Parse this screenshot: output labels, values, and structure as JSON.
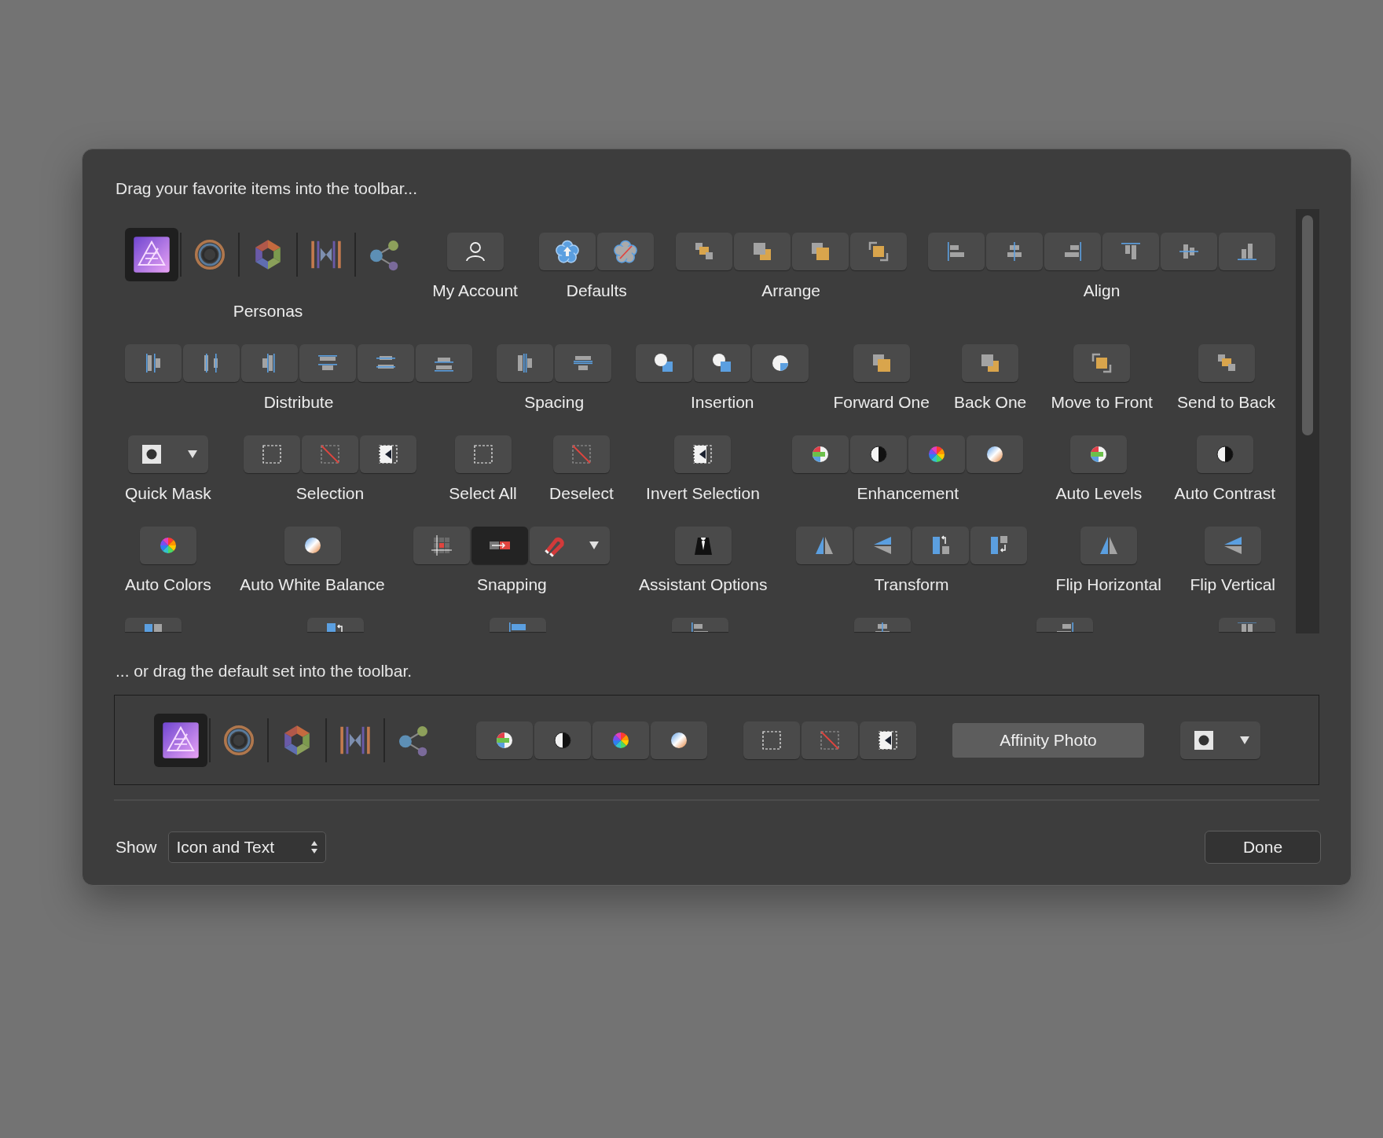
{
  "dialog": {
    "prompt": "Drag your favorite items into the toolbar...",
    "rows": [
      {
        "groups": [
          {
            "kind": "personas",
            "label": "Personas",
            "items": [
              {
                "kind": "photo",
                "selected": true
              },
              {
                "kind": "liquify",
                "selected": false
              },
              {
                "kind": "develop",
                "selected": false
              },
              {
                "kind": "tonemap",
                "selected": false
              },
              {
                "kind": "export",
                "selected": false
              }
            ]
          },
          {
            "kind": "buttons",
            "label": "My Account",
            "items": [
              {
                "kind": "user"
              }
            ]
          },
          {
            "kind": "buttons",
            "label": "Defaults",
            "items": [
              {
                "kind": "defaults-save"
              },
              {
                "kind": "defaults-reset"
              }
            ]
          },
          {
            "kind": "buttons",
            "label": "Arrange",
            "items": [
              {
                "kind": "send-back"
              },
              {
                "kind": "back-one"
              },
              {
                "kind": "forward-one"
              },
              {
                "kind": "to-front"
              }
            ]
          },
          {
            "kind": "buttons",
            "label": "Align",
            "items": [
              {
                "kind": "align-left"
              },
              {
                "kind": "align-center"
              },
              {
                "kind": "align-right"
              },
              {
                "kind": "align-top"
              },
              {
                "kind": "align-middle"
              },
              {
                "kind": "align-bottom"
              }
            ]
          }
        ]
      },
      {
        "groups": [
          {
            "kind": "buttons",
            "label": "Distribute",
            "items": [
              {
                "kind": "dist-left"
              },
              {
                "kind": "dist-center"
              },
              {
                "kind": "dist-right"
              },
              {
                "kind": "dist-top"
              },
              {
                "kind": "dist-middle"
              },
              {
                "kind": "dist-bottom"
              }
            ]
          },
          {
            "kind": "buttons",
            "label": "Spacing",
            "items": [
              {
                "kind": "space-h"
              },
              {
                "kind": "space-v"
              }
            ]
          },
          {
            "kind": "buttons",
            "label": "Insertion",
            "items": [
              {
                "kind": "ins-behind"
              },
              {
                "kind": "ins-front"
              },
              {
                "kind": "ins-inside"
              }
            ]
          },
          {
            "kind": "buttons",
            "label": "Forward One",
            "items": [
              {
                "kind": "forward-one"
              }
            ]
          },
          {
            "kind": "buttons",
            "label": "Back One",
            "items": [
              {
                "kind": "back-one"
              }
            ]
          },
          {
            "kind": "buttons",
            "label": "Move to Front",
            "items": [
              {
                "kind": "to-front"
              }
            ]
          },
          {
            "kind": "buttons",
            "label": "Send to Back",
            "items": [
              {
                "kind": "send-back"
              }
            ]
          }
        ]
      },
      {
        "groups": [
          {
            "kind": "buttons",
            "label": "Quick Mask",
            "dropdown": true,
            "items": [
              {
                "kind": "mask"
              }
            ]
          },
          {
            "kind": "buttons",
            "label": "Selection",
            "items": [
              {
                "kind": "select-all"
              },
              {
                "kind": "deselect"
              },
              {
                "kind": "invert"
              }
            ]
          },
          {
            "kind": "buttons",
            "label": "Select All",
            "items": [
              {
                "kind": "select-all"
              }
            ]
          },
          {
            "kind": "buttons",
            "label": "Deselect",
            "items": [
              {
                "kind": "deselect"
              }
            ]
          },
          {
            "kind": "buttons",
            "label": "Invert Selection",
            "items": [
              {
                "kind": "invert"
              }
            ]
          },
          {
            "kind": "buttons",
            "label": "Enhancement",
            "items": [
              {
                "kind": "levels"
              },
              {
                "kind": "contrast"
              },
              {
                "kind": "colors"
              },
              {
                "kind": "white-balance"
              }
            ]
          },
          {
            "kind": "buttons",
            "label": "Auto Levels",
            "items": [
              {
                "kind": "levels"
              }
            ]
          },
          {
            "kind": "buttons",
            "label": "Auto Contrast",
            "items": [
              {
                "kind": "contrast"
              }
            ]
          }
        ]
      },
      {
        "groups": [
          {
            "kind": "buttons",
            "label": "Auto Colors",
            "items": [
              {
                "kind": "colors"
              }
            ]
          },
          {
            "kind": "buttons",
            "label": "Auto White Balance",
            "items": [
              {
                "kind": "white-balance"
              }
            ]
          },
          {
            "kind": "buttons",
            "label": "Snapping",
            "dropdown": true,
            "items": [
              {
                "kind": "snap-grid",
                "on": false
              },
              {
                "kind": "snap-arrow",
                "on": true
              },
              {
                "kind": "magnet",
                "on": false
              }
            ]
          },
          {
            "kind": "buttons",
            "label": "Assistant Options",
            "items": [
              {
                "kind": "tuxedo"
              }
            ]
          },
          {
            "kind": "buttons",
            "label": "Transform",
            "items": [
              {
                "kind": "flip-h"
              },
              {
                "kind": "flip-v"
              },
              {
                "kind": "rot-left"
              },
              {
                "kind": "rot-right"
              }
            ]
          },
          {
            "kind": "buttons",
            "label": "Flip Horizontal",
            "items": [
              {
                "kind": "flip-h"
              }
            ]
          },
          {
            "kind": "buttons",
            "label": "Flip Vertical",
            "items": [
              {
                "kind": "flip-v"
              }
            ]
          }
        ]
      },
      {
        "groups": [
          {
            "kind": "buttons",
            "items": [
              {
                "kind": "two-squares"
              }
            ]
          },
          {
            "kind": "buttons",
            "items": [
              {
                "kind": "square-rotate"
              }
            ]
          },
          {
            "kind": "buttons",
            "items": [
              {
                "kind": "align-left-blue"
              }
            ]
          },
          {
            "kind": "buttons",
            "items": [
              {
                "kind": "align-left"
              }
            ]
          },
          {
            "kind": "buttons",
            "items": [
              {
                "kind": "align-center"
              }
            ]
          },
          {
            "kind": "buttons",
            "items": [
              {
                "kind": "align-right"
              }
            ]
          },
          {
            "kind": "buttons",
            "items": [
              {
                "kind": "align-top"
              }
            ]
          }
        ]
      }
    ],
    "default_prompt": "... or drag the default set into the toolbar.",
    "default_set": [
      {
        "kind": "personas",
        "items": [
          {
            "kind": "photo",
            "selected": true
          },
          {
            "kind": "liquify",
            "selected": false
          },
          {
            "kind": "develop",
            "selected": false
          },
          {
            "kind": "tonemap",
            "selected": false
          },
          {
            "kind": "export",
            "selected": false
          }
        ]
      },
      {
        "kind": "buttons",
        "items": [
          {
            "kind": "levels"
          },
          {
            "kind": "contrast"
          },
          {
            "kind": "colors"
          },
          {
            "kind": "white-balance"
          }
        ]
      },
      {
        "kind": "buttons",
        "items": [
          {
            "kind": "select-all"
          },
          {
            "kind": "deselect"
          },
          {
            "kind": "invert"
          }
        ]
      },
      {
        "kind": "text",
        "text": "Affinity Photo"
      },
      {
        "kind": "buttons",
        "dropdown": true,
        "items": [
          {
            "kind": "mask"
          }
        ]
      }
    ],
    "show_label": "Show",
    "show_value": "Icon and Text",
    "done": "Done"
  }
}
